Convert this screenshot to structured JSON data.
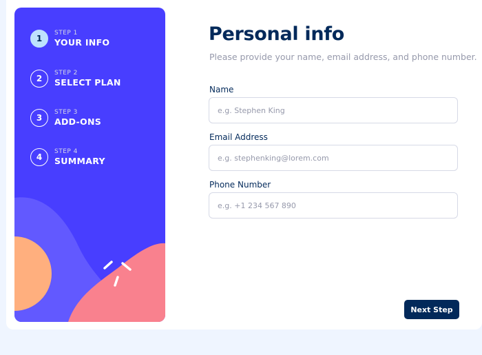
{
  "sidebar": {
    "steps": [
      {
        "number": "1",
        "label": "STEP 1",
        "title": "YOUR INFO",
        "active": true
      },
      {
        "number": "2",
        "label": "STEP 2",
        "title": "SELECT PLAN",
        "active": false
      },
      {
        "number": "3",
        "label": "STEP 3",
        "title": "ADD-ONS",
        "active": false
      },
      {
        "number": "4",
        "label": "STEP 4",
        "title": "SUMMARY",
        "active": false
      }
    ]
  },
  "main": {
    "title": "Personal info",
    "subtitle": "Please provide your name, email address, and phone number.",
    "fields": [
      {
        "label": "Name",
        "placeholder": "e.g. Stephen King",
        "value": ""
      },
      {
        "label": "Email Address",
        "placeholder": "e.g. stephenking@lorem.com",
        "value": ""
      },
      {
        "label": "Phone Number",
        "placeholder": "e.g. +1 234 567 890",
        "value": ""
      }
    ],
    "next_label": "Next Step"
  },
  "colors": {
    "page_background": "#eff5ff",
    "sidebar": "#483eff",
    "active_step": "#bee2fd",
    "primary": "#02295a",
    "muted_text": "#9699ab",
    "border": "#d6d9e6",
    "shape_orange": "#ffaf7e",
    "shape_pink": "#f9818e",
    "shape_violet": "#6259ff"
  }
}
